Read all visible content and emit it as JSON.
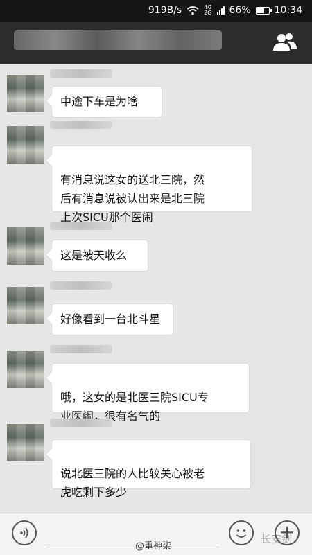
{
  "status_bar": {
    "speed": "919B/s",
    "network": "4G",
    "battery": "66%",
    "time": "10:34",
    "battery_level": 0.66
  },
  "header": {
    "title": "",
    "group_icon": "group-people-icon"
  },
  "messages": [
    {
      "text": "中途下车是为啥"
    },
    {
      "text": "有消息说这女的送北三院，然\n后有消息说被认出来是北三院\n上次SICU那个医闹"
    },
    {
      "text": "这是被天收么"
    },
    {
      "text": "好像看到一台北斗星"
    },
    {
      "text": "哦，这女的是北医三院SICU专\n业医闹，很有名气的"
    },
    {
      "text": "说北医三院的人比较关心被老\n虎吃剩下多少"
    }
  ],
  "input_bar": {
    "voice_icon": "voice-icon",
    "emoji_icon": "emoji-icon",
    "plus_icon": "plus-icon",
    "watermark_left": "@重神柒",
    "watermark_right": "长安剑"
  }
}
